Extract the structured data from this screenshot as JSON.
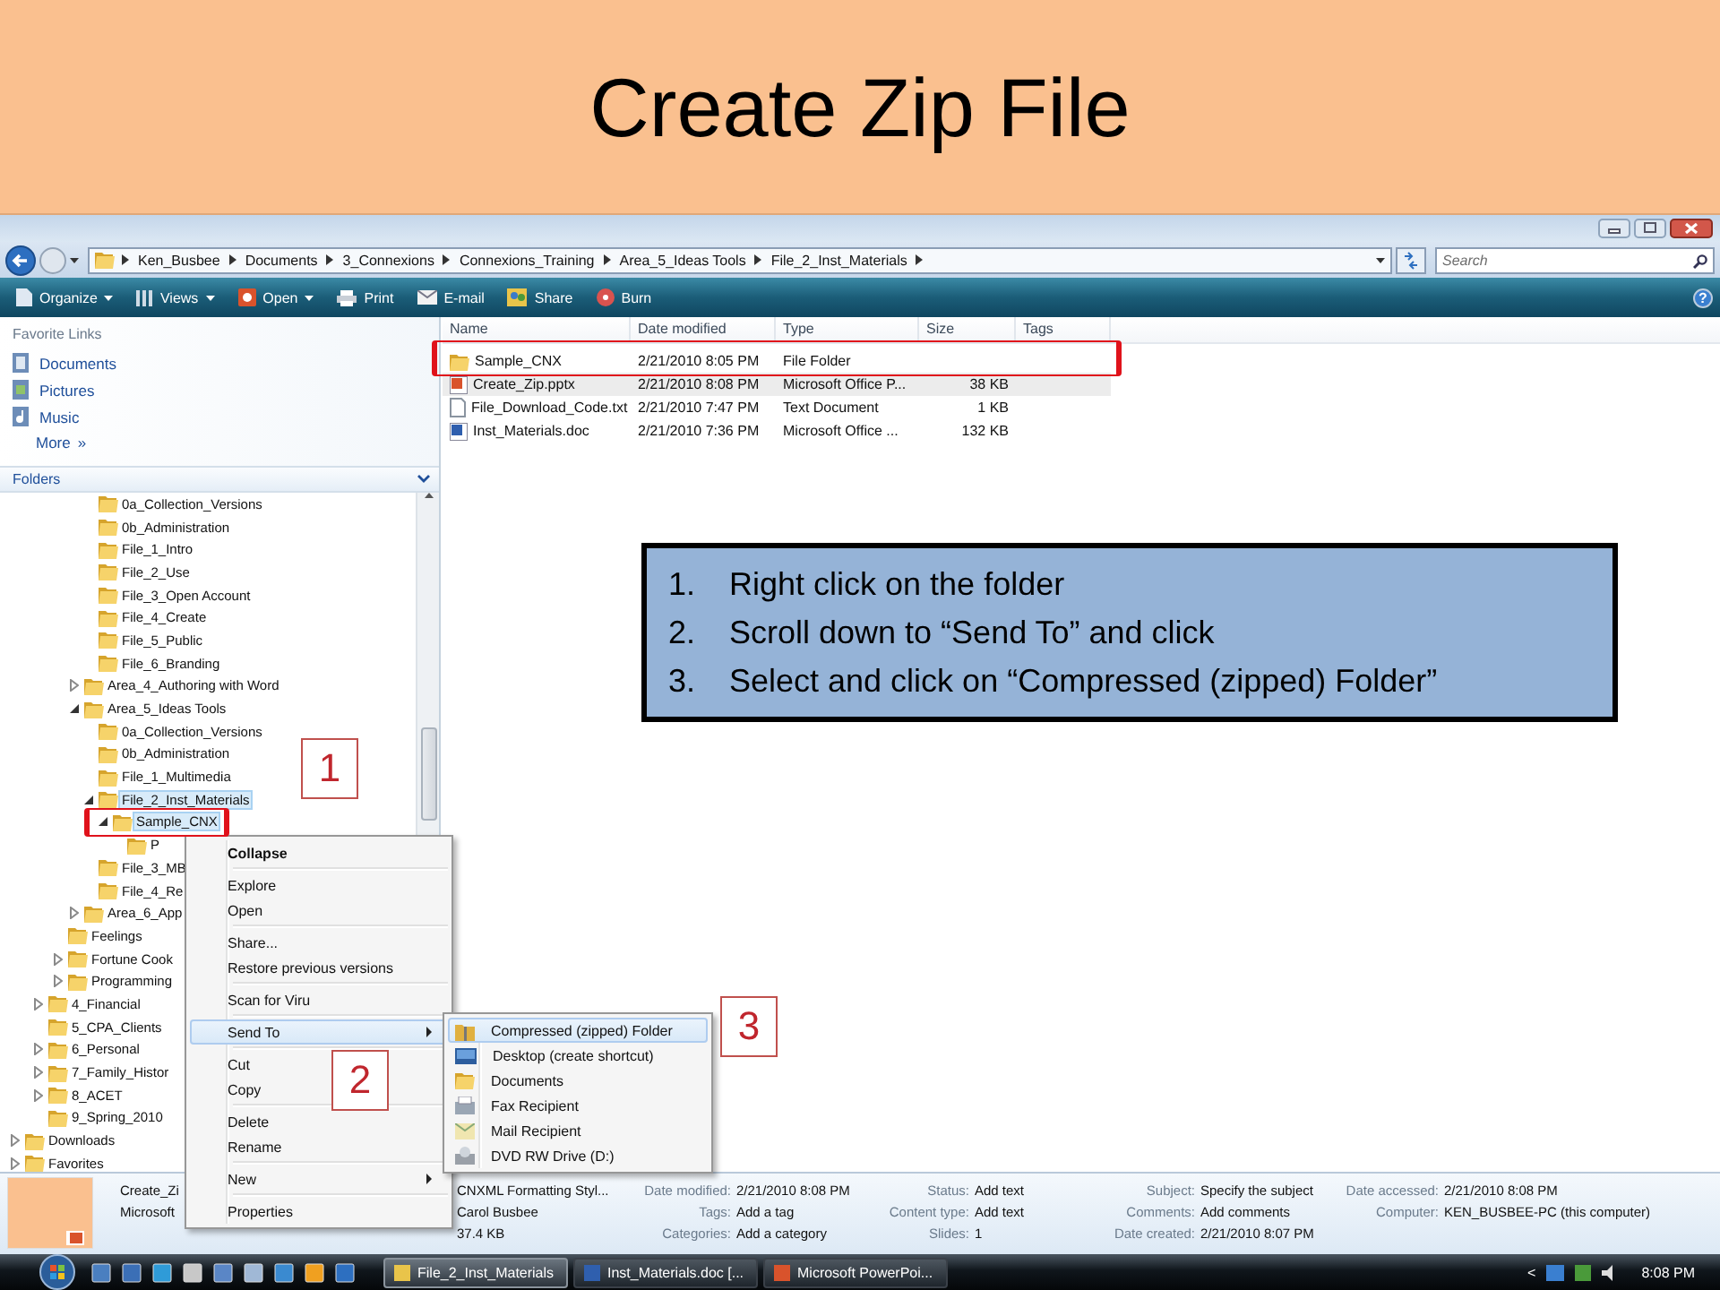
{
  "slide": {
    "title": "Create Zip File"
  },
  "window": {
    "address": {
      "crumbs": [
        "Ken_Busbee",
        "Documents",
        "3_Connexions",
        "Connexions_Training",
        "Area_5_Ideas Tools",
        "File_2_Inst_Materials"
      ],
      "search": {
        "placeholder": "Search"
      }
    },
    "toolbar": [
      {
        "label": "Organize",
        "dropdown": true
      },
      {
        "label": "Views",
        "dropdown": true
      },
      {
        "label": "Open",
        "dropdown": true
      },
      {
        "label": "Print",
        "dropdown": false
      },
      {
        "label": "E-mail",
        "dropdown": false
      },
      {
        "label": "Share",
        "dropdown": false
      },
      {
        "label": "Burn",
        "dropdown": false
      }
    ],
    "help": "?",
    "nav": {
      "favorites_heading": "Favorite Links",
      "favorites": [
        "Documents",
        "Pictures",
        "Music"
      ],
      "more": "More",
      "more_glyph": "»",
      "folders_heading": "Folders",
      "folders": [
        {
          "children": [
            {
              "children": [
                {
                  "children": [
                    {
                      "children": [
                        {
                          "label": "0a_Collection_Versions",
                          "selected": false
                        },
                        {
                          "label": "0b_Administration",
                          "selected": false
                        },
                        {
                          "label": "File_1_Intro",
                          "selected": false
                        },
                        {
                          "label": "File_2_Use",
                          "selected": false
                        },
                        {
                          "label": "File_3_Open Account",
                          "selected": false
                        },
                        {
                          "label": "File_4_Create",
                          "selected": false
                        },
                        {
                          "label": "File_5_Public",
                          "selected": false
                        },
                        {
                          "label": "File_6_Branding",
                          "selected": false
                        }
                      ]
                    },
                    {
                      "label": "Area_4_Authoring with Word",
                      "selected": false,
                      "expanded": false
                    },
                    {
                      "label": "Area_5_Ideas Tools",
                      "selected": false,
                      "expanded": true,
                      "children": [
                        {
                          "label": "0a_Collection_Versions",
                          "selected": false
                        },
                        {
                          "label": "0b_Administration",
                          "selected": false
                        },
                        {
                          "label": "File_1_Multimedia",
                          "selected": false
                        },
                        {
                          "label": "File_2_Inst_Materials",
                          "selected": true,
                          "expanded": true,
                          "children": [
                            {
                              "label": "Sample_CNX",
                              "selected": true,
                              "expanded": true,
                              "children": [
                                {
                                  "label": "P",
                                  "selected": false
                                }
                              ]
                            }
                          ]
                        },
                        {
                          "label": "File_3_MB",
                          "selected": false
                        },
                        {
                          "label": "File_4_Re",
                          "selected": false
                        }
                      ]
                    },
                    {
                      "label": "Area_6_App",
                      "selected": false,
                      "expanded": false
                    }
                  ]
                },
                {
                  "label": "Feelings",
                  "selected": false
                },
                {
                  "label": "Fortune Cook",
                  "selected": false,
                  "expanded": false
                },
                {
                  "label": "Programming",
                  "selected": false,
                  "expanded": false
                }
              ]
            },
            {
              "label": "4_Financial",
              "selected": false,
              "expanded": false
            },
            {
              "label": "5_CPA_Clients",
              "selected": false
            },
            {
              "label": "6_Personal",
              "selected": false,
              "expanded": false
            },
            {
              "label": "7_Family_Histor",
              "selected": false,
              "expanded": false
            },
            {
              "label": "8_ACET",
              "selected": false,
              "expanded": false
            },
            {
              "label": "9_Spring_2010",
              "selected": false
            }
          ]
        },
        {
          "label": "Downloads",
          "selected": false,
          "expanded": false
        },
        {
          "label": "Favorites",
          "selected": false,
          "expanded": false
        }
      ]
    },
    "file_list": {
      "columns": [
        "Name",
        "Date modified",
        "Type",
        "Size",
        "Tags"
      ],
      "rows": [
        {
          "name": "Sample_CNX",
          "date_modified": "2/21/2010 8:05 PM",
          "type": "File Folder",
          "selected": false
        },
        {
          "name": "Create_Zip.pptx",
          "date_modified": "2/21/2010 8:08 PM",
          "type": "Microsoft Office P...",
          "size": "38 KB",
          "selected": true
        },
        {
          "name": "File_Download_Code.txt",
          "date_modified": "2/21/2010 7:47 PM",
          "type": "Text Document",
          "size": "1 KB",
          "selected": false
        },
        {
          "name": "Inst_Materials.doc",
          "date_modified": "2/21/2010 7:36 PM",
          "type": "Microsoft Office ...",
          "size": "132 KB",
          "selected": false
        }
      ]
    },
    "details": {
      "name": "Create_Zi",
      "type": "Microsoft",
      "title": "CNXML Formatting Styl...",
      "author": "Carol Busbee",
      "size": "37.4 KB",
      "property_columns": [
        [
          {
            "label": "Date modified:",
            "value": "2/21/2010 8:08 PM"
          },
          {
            "label": "Tags:",
            "value": "Add a tag"
          },
          {
            "label": "Categories:",
            "value": "Add a category"
          }
        ],
        [
          {
            "label": "Status:",
            "value": "Add text"
          },
          {
            "label": "Content type:",
            "value": "Add text"
          },
          {
            "label": "Slides:",
            "value": "1"
          }
        ],
        [
          {
            "label": "Subject:",
            "value": "Specify the subject"
          },
          {
            "label": "Comments:",
            "value": "Add comments"
          },
          {
            "label": "Date created:",
            "value": "2/21/2010 8:07 PM"
          }
        ],
        [
          {
            "label": "Date accessed:",
            "value": "2/21/2010 8:08 PM"
          },
          {
            "label": "Computer:",
            "value": "KEN_BUSBEE-PC (this computer)"
          }
        ]
      ]
    }
  },
  "context_menu": {
    "items": [
      {
        "kind": "item",
        "label": "Collapse",
        "default": true,
        "selected": false,
        "submenu": false
      },
      {
        "kind": "separator"
      },
      {
        "kind": "item",
        "label": "Explore",
        "default": false,
        "selected": false,
        "submenu": false
      },
      {
        "kind": "item",
        "label": "Open",
        "default": false,
        "selected": false,
        "submenu": false
      },
      {
        "kind": "separator"
      },
      {
        "kind": "item",
        "label": "Share...",
        "default": false,
        "selected": false,
        "submenu": false
      },
      {
        "kind": "item",
        "label": "Restore previous versions",
        "default": false,
        "selected": false,
        "submenu": false
      },
      {
        "kind": "separator"
      },
      {
        "kind": "item",
        "label": "Scan for Viru",
        "default": false,
        "selected": false,
        "submenu": false
      },
      {
        "kind": "separator"
      },
      {
        "kind": "item",
        "label": "Send To",
        "default": false,
        "selected": true,
        "submenu": true
      },
      {
        "kind": "separator"
      },
      {
        "kind": "item",
        "label": "Cut",
        "default": false,
        "selected": false,
        "submenu": false
      },
      {
        "kind": "item",
        "label": "Copy",
        "default": false,
        "selected": false,
        "submenu": false
      },
      {
        "kind": "separator"
      },
      {
        "kind": "item",
        "label": "Delete",
        "default": false,
        "selected": false,
        "submenu": false
      },
      {
        "kind": "item",
        "label": "Rename",
        "default": false,
        "selected": false,
        "submenu": false
      },
      {
        "kind": "separator"
      },
      {
        "kind": "item",
        "label": "New",
        "default": false,
        "selected": false,
        "submenu": true
      },
      {
        "kind": "separator"
      },
      {
        "kind": "item",
        "label": "Properties",
        "default": false,
        "selected": false,
        "submenu": false
      }
    ]
  },
  "send_to_menu": {
    "items": [
      {
        "label": "Compressed (zipped) Folder",
        "selected": true
      },
      {
        "label": "Desktop (create shortcut)",
        "selected": false
      },
      {
        "label": "Documents",
        "selected": false
      },
      {
        "label": "Fax Recipient",
        "selected": false
      },
      {
        "label": "Mail Recipient",
        "selected": false
      },
      {
        "label": "DVD RW Drive (D:)",
        "selected": false
      }
    ]
  },
  "instructions": [
    {
      "number": "1.",
      "text": "Right click on the folder"
    },
    {
      "number": "2.",
      "text": "Scroll down to “Send To” and  click"
    },
    {
      "number": "3.",
      "text": "Select and click on “Compressed (zipped) Folder”"
    }
  ],
  "callouts": [
    "1",
    "2",
    "3"
  ],
  "taskbar": {
    "tasks": [
      {
        "label": "File_2_Inst_Materials",
        "selected": true
      },
      {
        "label": "Inst_Materials.doc [...",
        "selected": false
      },
      {
        "label": "Microsoft PowerPoi...",
        "selected": false
      }
    ],
    "tray_toggle": "<",
    "clock": "8:08 PM"
  }
}
